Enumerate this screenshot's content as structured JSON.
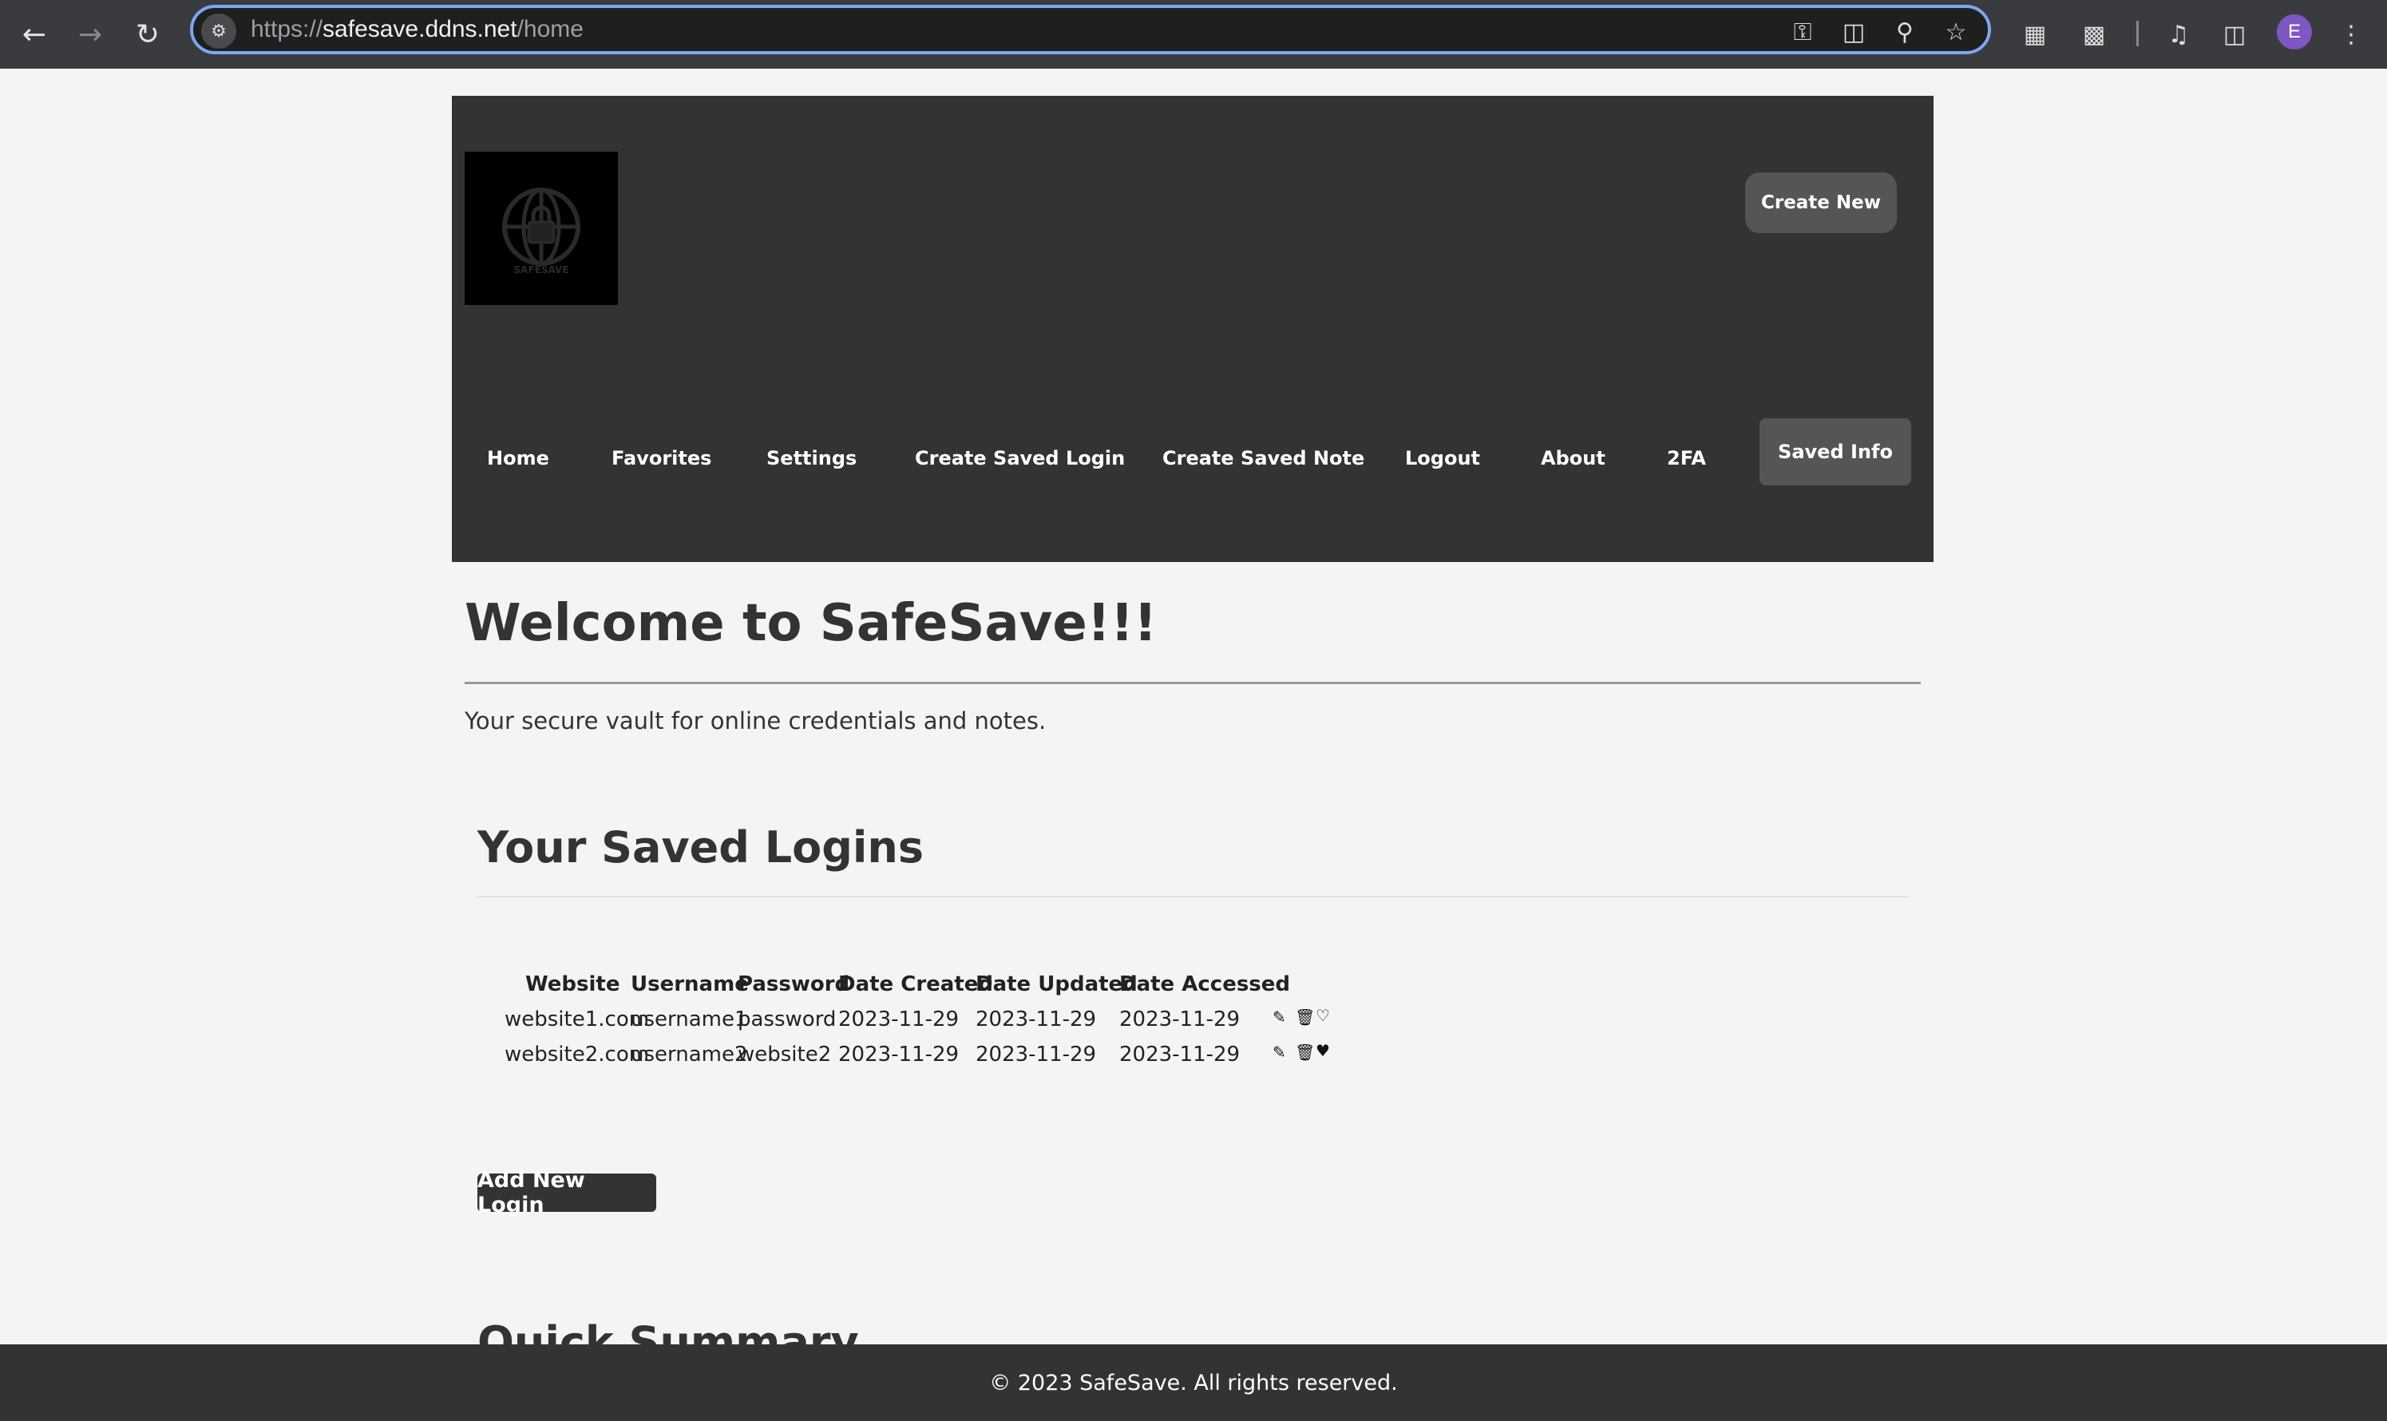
{
  "browser": {
    "url_prefix": "https://",
    "url_host": "safesave.ddns.net",
    "url_path": "/home",
    "avatar_letter": "E",
    "icons": [
      "back-icon",
      "forward-icon",
      "reload-icon",
      "site-info-icon",
      "key-icon",
      "install-icon",
      "zoom-icon",
      "star-icon",
      "qr-icon",
      "extensions-icon",
      "media-icon",
      "sidepanel-icon",
      "menu-icon"
    ]
  },
  "header": {
    "logo_text": "SAFESAVE",
    "create_new": "Create New",
    "nav": [
      "Home",
      "Favorites",
      "Settings",
      "Create Saved Login",
      "Create Saved Note",
      "Logout",
      "About",
      "2FA"
    ],
    "saved_info": "Saved Info"
  },
  "main": {
    "welcome": "Welcome to SafeSave!!!",
    "tagline": "Your secure vault for online credentials and notes.",
    "saved_logins_title": "Your Saved Logins",
    "columns": [
      "Website",
      "Username",
      "Password",
      "Date Created",
      "Date Updated",
      "Date Accessed"
    ],
    "rows": [
      {
        "website": "website1.com",
        "username": "username1",
        "password": "password",
        "created": "2023-11-29",
        "updated": "2023-11-29",
        "accessed": "2023-11-29",
        "favorite": false
      },
      {
        "website": "website2.com",
        "username": "username2",
        "password": "website2",
        "created": "2023-11-29",
        "updated": "2023-11-29",
        "accessed": "2023-11-29",
        "favorite": true
      }
    ],
    "add_new_login": "Add New Login",
    "quick_summary": "Quick Summary"
  },
  "footer": {
    "text": "© 2023 SafeSave. All rights reserved."
  },
  "colors": {
    "header_bg": "#333333",
    "button_bg": "#555555",
    "page_bg": "#f4f4f4",
    "omnibox_border": "#7ca7f2"
  }
}
